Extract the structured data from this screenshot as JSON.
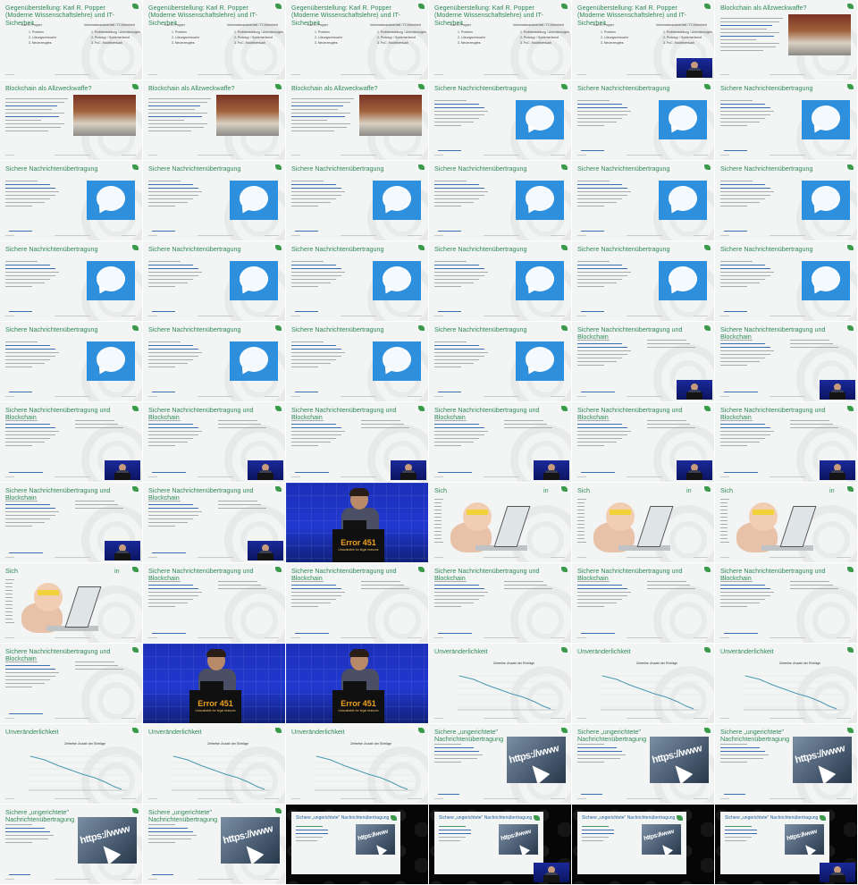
{
  "grid": {
    "cols": 6,
    "rows": 11
  },
  "colors": {
    "accent_green": "#2e8b57",
    "signal_blue": "#2e8fdd",
    "stage_blue": "#1b2fb8",
    "error_orange": "#f0a020"
  },
  "tiles": [
    {
      "kind": "popper",
      "title": "Gegenüberstellung: Karl R. Popper (Moderne Wissenschaftslehre) und IT-Sicherheit",
      "cam": false,
      "col1": [
        "Karl R. Popper",
        "1. Problem",
        "2. Lösungsversuche",
        "3. Neuerzeugtes"
      ],
      "col2": [
        "Informationssicherheit / IT-Sicherheit",
        "1. Problemstellung / Anforderungen",
        "2. Prototyp / Systementwurf",
        "3. PoC, Modellversuch"
      ]
    },
    {
      "kind": "popper",
      "title": "Gegenüberstellung: Karl R. Popper (Moderne Wissenschaftslehre) und IT-Sicherheit",
      "cam": false,
      "col1": [
        "Karl R. Popper",
        "1. Problem",
        "2. Lösungsversuche",
        "3. Neuerzeugtes"
      ],
      "col2": [
        "Informationssicherheit / IT-Sicherheit",
        "1. Problemstellung / Anforderungen",
        "2. Prototyp / Systementwurf",
        "3. PoC, Modellversuch"
      ]
    },
    {
      "kind": "popper",
      "title": "Gegenüberstellung: Karl R. Popper (Moderne Wissenschaftslehre) und IT-Sicherheit",
      "cam": false,
      "col1": [
        "Karl R. Popper",
        "1. Problem",
        "2. Lösungsversuche",
        "3. Neuerzeugtes"
      ],
      "col2": [
        "Informationssicherheit / IT-Sicherheit",
        "1. Problemstellung / Anforderungen",
        "2. Prototyp / Systementwurf",
        "3. PoC, Modellversuch"
      ]
    },
    {
      "kind": "popper",
      "title": "Gegenüberstellung: Karl R. Popper (Moderne Wissenschaftslehre) und IT-Sicherheit",
      "cam": false,
      "col1": [
        "Karl R. Popper",
        "1. Problem",
        "2. Lösungsversuche",
        "3. Neuerzeugtes"
      ],
      "col2": [
        "Informationssicherheit / IT-Sicherheit",
        "1. Problemstellung / Anforderungen",
        "2. Prototyp / Systementwurf",
        "3. PoC, Modellversuch"
      ]
    },
    {
      "kind": "popper",
      "title": "Gegenüberstellung: Karl R. Popper (Moderne Wissenschaftslehre) und IT-Sicherheit",
      "cam": true,
      "col1": [
        "Karl R. Popper",
        "1. Problem",
        "2. Lösungsversuche",
        "3. Neuerzeugtes"
      ],
      "col2": [
        "Informationssicherheit / IT-Sicherheit",
        "1. Problemstellung / Anforderungen",
        "2. Prototyp / Systementwurf",
        "3. PoC, Modellversuch"
      ]
    },
    {
      "kind": "blockchain",
      "title": "Blockchain als Allzweckwaffe?",
      "cam": false
    },
    {
      "kind": "blockchain",
      "title": "Blockchain als Allzweckwaffe?",
      "cam": false
    },
    {
      "kind": "blockchain",
      "title": "Blockchain als Allzweckwaffe?",
      "cam": false
    },
    {
      "kind": "blockchain",
      "title": "Blockchain als Allzweckwaffe?",
      "cam": false
    },
    {
      "kind": "signal",
      "title": "Sichere Nachrichtenübertragung",
      "cam": false
    },
    {
      "kind": "signal",
      "title": "Sichere Nachrichtenübertragung",
      "cam": false
    },
    {
      "kind": "signal",
      "title": "Sichere Nachrichtenübertragung",
      "cam": false
    },
    {
      "kind": "signal",
      "title": "Sichere Nachrichtenübertragung",
      "cam": false
    },
    {
      "kind": "signal",
      "title": "Sichere Nachrichtenübertragung",
      "cam": false
    },
    {
      "kind": "signal",
      "title": "Sichere Nachrichtenübertragung",
      "cam": false
    },
    {
      "kind": "signal",
      "title": "Sichere Nachrichtenübertragung",
      "cam": false
    },
    {
      "kind": "signal",
      "title": "Sichere Nachrichtenübertragung",
      "cam": false
    },
    {
      "kind": "signal",
      "title": "Sichere Nachrichtenübertragung",
      "cam": false
    },
    {
      "kind": "signal",
      "title": "Sichere Nachrichtenübertragung",
      "cam": false
    },
    {
      "kind": "signal",
      "title": "Sichere Nachrichtenübertragung",
      "cam": false
    },
    {
      "kind": "signal",
      "title": "Sichere Nachrichtenübertragung",
      "cam": false
    },
    {
      "kind": "signal",
      "title": "Sichere Nachrichtenübertragung",
      "cam": false
    },
    {
      "kind": "signal",
      "title": "Sichere Nachrichtenübertragung",
      "cam": false
    },
    {
      "kind": "signal",
      "title": "Sichere Nachrichtenübertragung",
      "cam": false
    },
    {
      "kind": "signal",
      "title": "Sichere Nachrichtenübertragung",
      "cam": false
    },
    {
      "kind": "signal",
      "title": "Sichere Nachrichtenübertragung",
      "cam": false
    },
    {
      "kind": "signal",
      "title": "Sichere Nachrichtenübertragung",
      "cam": false
    },
    {
      "kind": "signal",
      "title": "Sichere Nachrichtenübertragung",
      "cam": false
    },
    {
      "kind": "bc",
      "title": "Sichere Nachrichtenübertragung und Blockchain",
      "cam": true
    },
    {
      "kind": "bc",
      "title": "Sichere Nachrichtenübertragung und Blockchain",
      "cam": true
    },
    {
      "kind": "bc",
      "title": "Sichere Nachrichtenübertragung und Blockchain",
      "cam": true
    },
    {
      "kind": "bc",
      "title": "Sichere Nachrichtenübertragung und Blockchain",
      "cam": true
    },
    {
      "kind": "bc",
      "title": "Sichere Nachrichtenübertragung und Blockchain",
      "cam": true
    },
    {
      "kind": "bc",
      "title": "Sichere Nachrichtenübertragung und Blockchain",
      "cam": true
    },
    {
      "kind": "bc",
      "title": "Sichere Nachrichtenübertragung und Blockchain",
      "cam": true
    },
    {
      "kind": "bc",
      "title": "Sichere Nachrichtenübertragung und Blockchain",
      "cam": true
    },
    {
      "kind": "bc",
      "title": "Sichere Nachrichtenübertragung und Blockchain",
      "cam": true
    },
    {
      "kind": "bc",
      "title": "Sichere Nachrichtenübertragung und Blockchain",
      "cam": true
    },
    {
      "kind": "stage",
      "error": "Error 451",
      "sub": "Unavailable for legal reasons"
    },
    {
      "kind": "baby",
      "title": "Sich",
      "title2": "in"
    },
    {
      "kind": "baby",
      "title": "Sich",
      "title2": "in"
    },
    {
      "kind": "baby",
      "title": "Sich",
      "title2": "in"
    },
    {
      "kind": "baby",
      "title": "Sich",
      "title2": "in"
    },
    {
      "kind": "bc",
      "title": "Sichere Nachrichtenübertragung und Blockchain",
      "cam": false
    },
    {
      "kind": "bc",
      "title": "Sichere Nachrichtenübertragung und Blockchain",
      "cam": false
    },
    {
      "kind": "bc",
      "title": "Sichere Nachrichtenübertragung und Blockchain",
      "cam": false
    },
    {
      "kind": "bc",
      "title": "Sichere Nachrichtenübertragung und Blockchain",
      "cam": false
    },
    {
      "kind": "bc",
      "title": "Sichere Nachrichtenübertragung und Blockchain",
      "cam": false
    },
    {
      "kind": "bc",
      "title": "Sichere Nachrichtenübertragung und Blockchain",
      "cam": false
    },
    {
      "kind": "stage",
      "error": "Error 451",
      "sub": "Unavailable for legal reasons"
    },
    {
      "kind": "stage",
      "error": "Error 451",
      "sub": "Unavailable for legal reasons"
    },
    {
      "kind": "chart",
      "title": "Unveränderlichkeit",
      "chart_title": "Zeitreihe: Anzahl der Einträge"
    },
    {
      "kind": "chart",
      "title": "Unveränderlichkeit",
      "chart_title": "Zeitreihe: Anzahl der Einträge"
    },
    {
      "kind": "chart",
      "title": "Unveränderlichkeit",
      "chart_title": "Zeitreihe: Anzahl der Einträge"
    },
    {
      "kind": "chart",
      "title": "Unveränderlichkeit",
      "chart_title": "Zeitreihe: Anzahl der Einträge"
    },
    {
      "kind": "chart",
      "title": "Unveränderlichkeit",
      "chart_title": "Zeitreihe: Anzahl der Einträge"
    },
    {
      "kind": "chart",
      "title": "Unveränderlichkeit",
      "chart_title": "Zeitreihe: Anzahl der Einträge"
    },
    {
      "kind": "url",
      "title": "Sichere „ungerichtete\" Nachrichtenübertragung",
      "url": "https://www"
    },
    {
      "kind": "url",
      "title": "Sichere „ungerichtete\" Nachrichtenübertragung",
      "url": "https://www"
    },
    {
      "kind": "url",
      "title": "Sichere „ungerichtete\" Nachrichtenübertragung",
      "url": "https://www"
    },
    {
      "kind": "url",
      "title": "Sichere „ungerichtete\" Nachrichtenübertragung",
      "url": "https://www"
    },
    {
      "kind": "url",
      "title": "Sichere „ungerichtete\" Nachrichtenübertragung",
      "url": "https://www"
    },
    {
      "kind": "frame",
      "title": "Sichere „ungerichtete\" Nachrichtenübertragung",
      "url": "https://www",
      "cam": false
    },
    {
      "kind": "frame",
      "title": "Sichere „ungerichtete\" Nachrichtenübertragung",
      "url": "https://www",
      "cam": true
    },
    {
      "kind": "frame",
      "title": "Sichere „ungerichtete\" Nachrichtenübertragung",
      "url": "https://www",
      "cam": false
    },
    {
      "kind": "frame",
      "title": "Sichere „ungerichtete\" Nachrichtenübertragung",
      "url": "https://www",
      "cam": true
    }
  ]
}
